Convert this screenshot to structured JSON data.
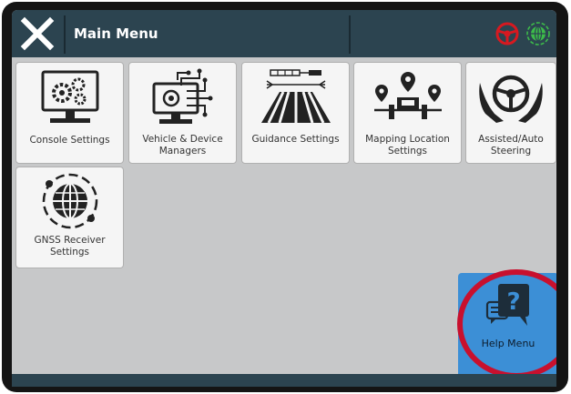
{
  "header": {
    "title": "Main Menu",
    "status_icons": [
      "steering-wheel-icon",
      "gnss-globe-icon"
    ],
    "colors": {
      "steering_status": "#d71920",
      "gnss_status": "#3dbb4a",
      "bar": "#2c4450"
    }
  },
  "menu": {
    "tiles": [
      {
        "label": "Console Settings",
        "icon": "console-settings-icon"
      },
      {
        "label": "Vehicle & Device\nManagers",
        "icon": "vehicle-device-icon"
      },
      {
        "label": "Guidance Settings",
        "icon": "guidance-icon"
      },
      {
        "label": "Mapping Location\nSettings",
        "icon": "mapping-location-icon"
      },
      {
        "label": "Assisted/Auto\nSteering",
        "icon": "steering-icon"
      },
      {
        "label": "GNSS Receiver\nSettings",
        "icon": "gnss-receiver-icon"
      }
    ]
  },
  "help": {
    "label": "Help Menu",
    "highlight_color": "#c8102e",
    "tile_color": "#3c8fd6"
  }
}
